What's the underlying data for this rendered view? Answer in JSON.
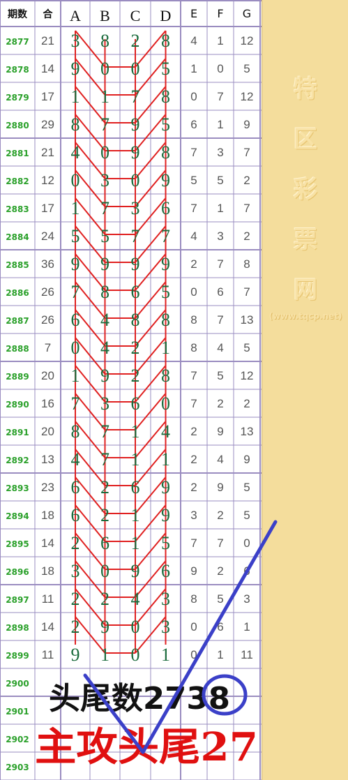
{
  "table": {
    "headers": [
      "期数",
      "合",
      "A",
      "B",
      "C",
      "D",
      "E",
      "F",
      "G"
    ],
    "rows": [
      [
        "2877",
        "21",
        "3",
        "8",
        "2",
        "8",
        "4",
        "1",
        "12"
      ],
      [
        "2878",
        "14",
        "9",
        "0",
        "0",
        "5",
        "1",
        "0",
        "5"
      ],
      [
        "2879",
        "17",
        "1",
        "1",
        "7",
        "8",
        "0",
        "7",
        "12"
      ],
      [
        "2880",
        "29",
        "8",
        "7",
        "9",
        "5",
        "6",
        "1",
        "9"
      ],
      [
        "2881",
        "21",
        "4",
        "0",
        "9",
        "8",
        "7",
        "3",
        "7"
      ],
      [
        "2882",
        "12",
        "0",
        "3",
        "0",
        "9",
        "5",
        "5",
        "2"
      ],
      [
        "2883",
        "17",
        "1",
        "7",
        "3",
        "6",
        "7",
        "1",
        "7"
      ],
      [
        "2884",
        "24",
        "5",
        "5",
        "7",
        "7",
        "4",
        "3",
        "2"
      ],
      [
        "2885",
        "36",
        "9",
        "9",
        "9",
        "9",
        "2",
        "7",
        "8"
      ],
      [
        "2886",
        "26",
        "7",
        "8",
        "6",
        "5",
        "0",
        "6",
        "7"
      ],
      [
        "2887",
        "26",
        "6",
        "4",
        "8",
        "8",
        "8",
        "7",
        "13"
      ],
      [
        "2888",
        "7",
        "0",
        "4",
        "2",
        "1",
        "8",
        "4",
        "5"
      ],
      [
        "2889",
        "20",
        "1",
        "9",
        "2",
        "8",
        "7",
        "5",
        "12"
      ],
      [
        "2890",
        "16",
        "7",
        "3",
        "6",
        "0",
        "7",
        "2",
        "2"
      ],
      [
        "2891",
        "20",
        "8",
        "7",
        "1",
        "4",
        "2",
        "9",
        "13"
      ],
      [
        "2892",
        "13",
        "4",
        "7",
        "1",
        "1",
        "2",
        "4",
        "9"
      ],
      [
        "2893",
        "23",
        "6",
        "2",
        "6",
        "9",
        "2",
        "9",
        "5"
      ],
      [
        "2894",
        "18",
        "6",
        "2",
        "1",
        "9",
        "3",
        "2",
        "5"
      ],
      [
        "2895",
        "14",
        "2",
        "6",
        "1",
        "5",
        "7",
        "7",
        "0"
      ],
      [
        "2896",
        "18",
        "3",
        "0",
        "9",
        "6",
        "9",
        "2",
        "6"
      ],
      [
        "2897",
        "11",
        "2",
        "2",
        "4",
        "3",
        "8",
        "5",
        "3"
      ],
      [
        "2898",
        "14",
        "2",
        "9",
        "0",
        "3",
        "0",
        "6",
        "1"
      ],
      [
        "2899",
        "11",
        "9",
        "1",
        "0",
        "1",
        "0",
        "1",
        "11"
      ],
      [
        "2900",
        "",
        "",
        "",
        "",
        "",
        "",
        "",
        ""
      ],
      [
        "2901",
        "",
        "",
        "",
        "",
        "",
        "",
        "",
        ""
      ],
      [
        "2902",
        "",
        "",
        "",
        "",
        "",
        "",
        "",
        ""
      ],
      [
        "2903",
        "",
        "",
        "",
        "",
        "",
        "",
        "",
        ""
      ]
    ]
  },
  "chart_data": {
    "type": "table",
    "columns": [
      "期数",
      "合",
      "A",
      "B",
      "C",
      "D",
      "E",
      "F",
      "G"
    ],
    "digit_columns": [
      "A",
      "B",
      "C",
      "D"
    ]
  },
  "annotations": {
    "line1": "头尾数2738",
    "line2": "主攻头尾27"
  },
  "side_panel": {
    "chars": [
      "特",
      "区",
      "彩",
      "票",
      "网"
    ],
    "url": "(www.tqcp.net)"
  },
  "colors": {
    "period": "#2aa02a",
    "sum": "#555555",
    "digit": "#1a6b3c",
    "border": "#9a8cc0",
    "zigzag": "#e02020",
    "check": "#3b40c8",
    "text_red": "#e01010",
    "text_black": "#111111",
    "panel": "#f4dd9c"
  }
}
